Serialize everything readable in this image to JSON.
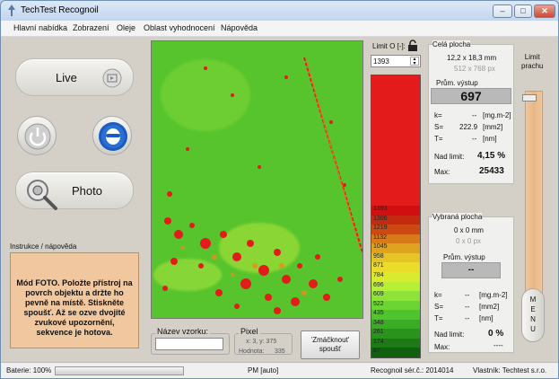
{
  "window": {
    "title": "TechTest Recognoil",
    "min_label": "–",
    "max_label": "□",
    "close_label": "✕"
  },
  "menu": [
    "Hlavní nabídka",
    "Zobrazení",
    "Oleje",
    "Oblast vyhodnocení",
    "Nápověda"
  ],
  "left": {
    "live_label": "Live",
    "photo_label": "Photo",
    "instructions_title": "Instrukce / nápověda",
    "instructions_text": "Mód FOTO. Položte přístroj na povrch objektu a držte ho pevně na místě. Stiskněte spoušť. Až se ozve dvojité zvukové upozornění, sekvence je hotova."
  },
  "bottom": {
    "sample_label": "Název vzorku:",
    "sample_value": "",
    "pixel_title": "Pixel",
    "pixel_coords": "x: 3, y: 375",
    "value_label": "Hodnota:",
    "value": "335",
    "trigger_label": "'Zmáčknout'\nspoušť"
  },
  "limit": {
    "title": "Limit O [-]:",
    "value": "1393",
    "lock_icon": "lock-icon"
  },
  "colorbar": {
    "labels": [
      "1393",
      "1306",
      "1219",
      "1132",
      "1045",
      "958",
      "871",
      "784",
      "696",
      "609",
      "522",
      "435",
      "348",
      "261",
      "174",
      "87"
    ],
    "colors": [
      "#d01010",
      "#c42a10",
      "#cc4a12",
      "#d77a18",
      "#e0a320",
      "#e6c425",
      "#ecdc2a",
      "#d9ea2f",
      "#b7ef35",
      "#8ee338",
      "#6dd533",
      "#4fc42c",
      "#39ab24",
      "#2a931c",
      "#1d7a15",
      "#11600e"
    ]
  },
  "whole": {
    "title": "Celá plocha",
    "size_mm": "12,2 x 18,3 mm",
    "size_px": "512 x 768 px",
    "avg_label": "Prům. výstup",
    "avg_value": "697",
    "k_label": "k=",
    "k_value": "--",
    "k_unit": "[mg.m-2]",
    "s_label": "S=",
    "s_value": "222.9",
    "s_unit": "[mm2]",
    "t_label": "T=",
    "t_value": "--",
    "t_unit": "[nm]",
    "over_label": "Nad limit:",
    "over_value": "4,15 %",
    "max_label": "Max:",
    "max_value": "25433"
  },
  "selected": {
    "title": "Vybraná plocha",
    "size_mm": "0 x 0 mm",
    "size_px": "0 x 0 px",
    "avg_label": "Prům. výstup",
    "avg_value": "--",
    "k_label": "k=",
    "k_value": "--",
    "k_unit": "[mg.m-2]",
    "s_label": "S=",
    "s_value": "--",
    "s_unit": "[mm2]",
    "t_label": "T=",
    "t_value": "--",
    "t_unit": "[nm]",
    "over_label": "Nad limit:",
    "over_value": "0 %",
    "max_label": "Max:",
    "max_value": "----"
  },
  "right": {
    "limit_title": "Limit\nprachu",
    "menu_label": "M\nE\nN\nU",
    "slider_level": 0.97
  },
  "status": {
    "battery_label": "Baterie: 100%",
    "battery_level": 1.0,
    "mode": "PM [auto]",
    "serial": "Recognoil sér.č.: 2014014",
    "owner": "Vlastník: Techtest s.r.o."
  },
  "colors": {
    "accent_red": "#e41b1b",
    "panel_orange": "#f0c79e",
    "titlebar": "#c3d6ee"
  }
}
